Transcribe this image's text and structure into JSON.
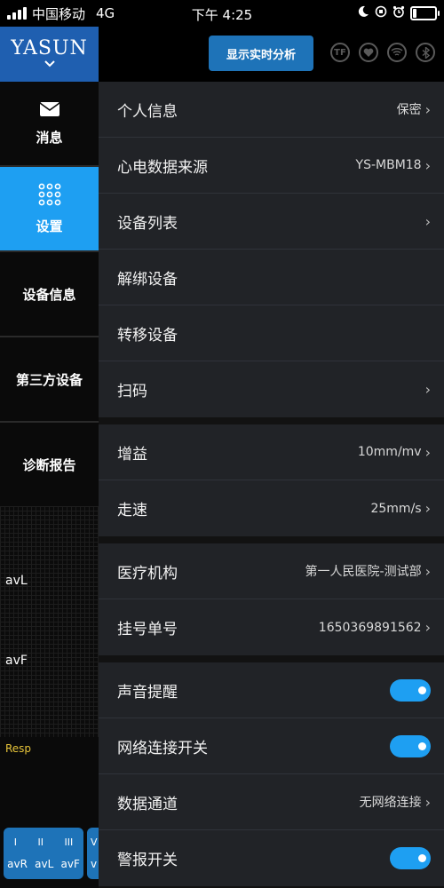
{
  "status": {
    "carrier": "中国移动",
    "network": "4G",
    "time": "下午 4:25",
    "battery_level": 0.2
  },
  "sidebar": {
    "logo": "YASUN",
    "items": [
      {
        "label": "消息",
        "icon": "mail-icon"
      },
      {
        "label": "设置",
        "icon": "grid-icon",
        "active": true
      },
      {
        "label": "设备信息"
      },
      {
        "label": "第三方设备"
      },
      {
        "label": "诊断报告"
      }
    ],
    "leads": [
      "avL",
      "avF"
    ],
    "resp": "Resp",
    "lead_buttons": {
      "top": [
        "I",
        "II",
        "III"
      ],
      "bottom": [
        "avR",
        "avL",
        "avF"
      ],
      "extra_top": "V",
      "extra_bottom": "v"
    }
  },
  "header": {
    "realtime_button": "显示实时分析",
    "icons": [
      "tf-icon",
      "heart-icon",
      "wifi-icon",
      "bluetooth-icon"
    ],
    "tf_label": "TF"
  },
  "settings": {
    "group1": [
      {
        "label": "个人信息",
        "value": "保密",
        "arrow": true
      },
      {
        "label": "心电数据来源",
        "value": "YS-MBM18",
        "arrow": true
      },
      {
        "label": "设备列表",
        "value": "",
        "arrow": true
      },
      {
        "label": "解绑设备",
        "value": "",
        "arrow": false
      },
      {
        "label": "转移设备",
        "value": "",
        "arrow": false
      },
      {
        "label": "扫码",
        "value": "",
        "arrow": true
      }
    ],
    "group2": [
      {
        "label": "增益",
        "value": "10mm/mv",
        "arrow": true
      },
      {
        "label": "走速",
        "value": "25mm/s",
        "arrow": true
      }
    ],
    "group3": [
      {
        "label": "医疗机构",
        "value": "第一人民医院-测试部",
        "arrow": true
      },
      {
        "label": "挂号单号",
        "value": "1650369891562",
        "arrow": true
      }
    ],
    "group4": [
      {
        "label": "声音提醒",
        "toggle": true
      },
      {
        "label": "网络连接开关",
        "toggle": true
      },
      {
        "label": "数据通道",
        "value": "无网络连接",
        "arrow": true
      },
      {
        "label": "警报开关",
        "toggle": true
      }
    ],
    "arrow_glyph": "›"
  },
  "colors": {
    "accent": "#1e9ff2",
    "button": "#1e73b8",
    "logo_bg": "#1f5fb0",
    "row_bg": "#212327"
  }
}
